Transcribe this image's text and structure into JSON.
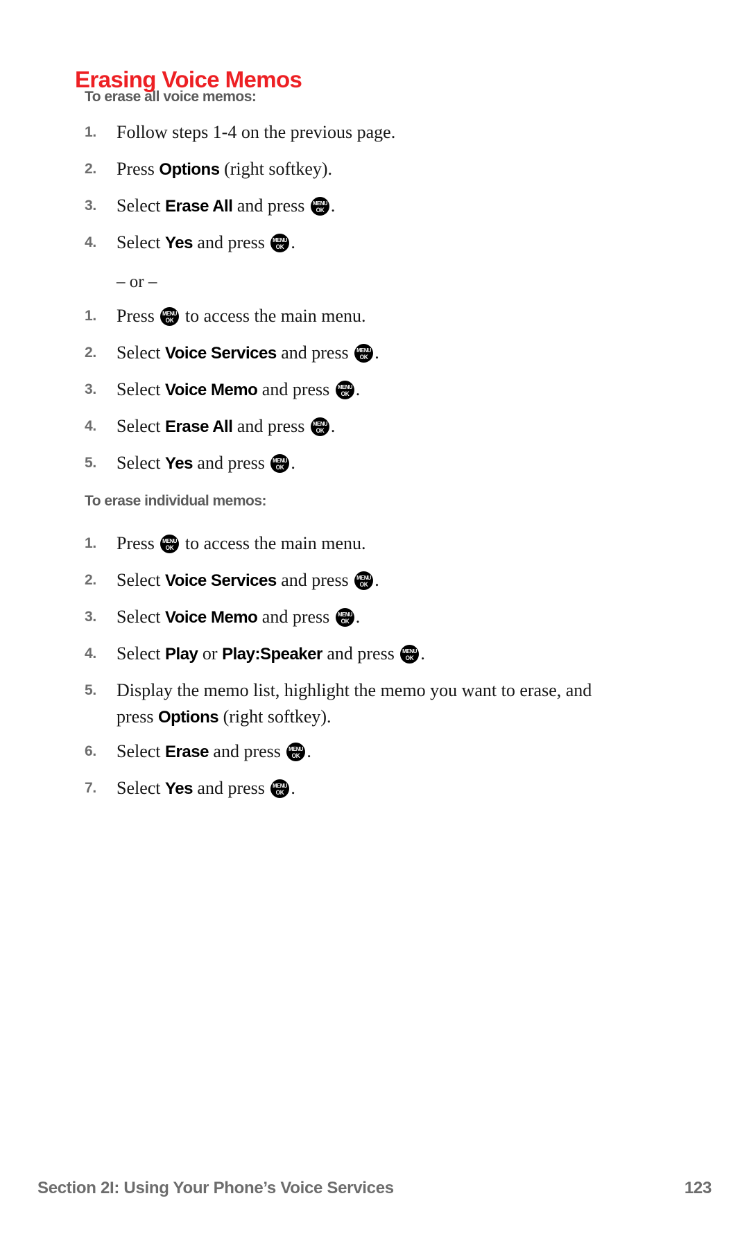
{
  "document": {
    "title": "Erasing Voice Memos",
    "title_color": "#ed2024",
    "subhead_color": "#5b5b5b",
    "or_separator": "– or –"
  },
  "icons": {
    "menu_ok": {
      "line1": "MENU",
      "line2": "OK"
    }
  },
  "sections": [
    {
      "subhead": "To erase all voice memos:",
      "steps": [
        {
          "num": "1.",
          "text": "Follow steps 1-4 on the previous page."
        },
        {
          "num": "2.",
          "pre": "Press ",
          "bold": "Options",
          "post": " (right softkey)."
        },
        {
          "num": "3.",
          "pre": "Select ",
          "bold": "Erase All",
          "post": " and press ",
          "icon": "menu_ok",
          "tail": "."
        },
        {
          "num": "4.",
          "pre": "Select ",
          "bold": "Yes",
          "post": " and press ",
          "icon": "menu_ok",
          "tail": "."
        }
      ],
      "steps_after_or": [
        {
          "num": "1.",
          "pre": "Press ",
          "icon": "menu_ok",
          "tail": " to access the main menu."
        },
        {
          "num": "2.",
          "pre": "Select ",
          "bold": "Voice Services",
          "post": " and press ",
          "icon": "menu_ok",
          "tail": "."
        },
        {
          "num": "3.",
          "pre": "Select ",
          "bold": "Voice Memo",
          "post": " and press ",
          "icon": "menu_ok",
          "tail": "."
        },
        {
          "num": "4.",
          "pre": "Select ",
          "bold": "Erase All",
          "post": " and press ",
          "icon": "menu_ok",
          "tail": "."
        },
        {
          "num": "5.",
          "pre": "Select ",
          "bold": "Yes",
          "post": " and press ",
          "icon": "menu_ok",
          "tail": "."
        }
      ]
    },
    {
      "subhead": "To erase individual memos:",
      "steps": [
        {
          "num": "1.",
          "pre": "Press ",
          "icon": "menu_ok",
          "tail": " to access the main menu."
        },
        {
          "num": "2.",
          "pre": "Select ",
          "bold": "Voice Services",
          "post": " and press ",
          "icon": "menu_ok",
          "tail": "."
        },
        {
          "num": "3.",
          "pre": "Select ",
          "bold": "Voice Memo",
          "post": " and press ",
          "icon": "menu_ok",
          "tail": "."
        },
        {
          "num": "4.",
          "pre": "Select ",
          "bold": "Play",
          "mid": " or ",
          "bold2": "Play:Speaker",
          "post": " and press ",
          "icon": "menu_ok",
          "tail": "."
        },
        {
          "num": "5.",
          "pre": "Display the memo list, highlight the memo you want to erase, and press ",
          "bold": "Options",
          "post": " (right softkey)."
        },
        {
          "num": "6.",
          "pre": "Select ",
          "bold": "Erase",
          "post": " and press ",
          "icon": "menu_ok",
          "tail": "."
        },
        {
          "num": "7.",
          "pre": "Select ",
          "bold": "Yes",
          "post": " and press ",
          "icon": "menu_ok",
          "tail": "."
        }
      ]
    }
  ],
  "footer": {
    "section_label": "Section 2I: Using Your Phone’s Voice Services",
    "page_number": "123"
  }
}
